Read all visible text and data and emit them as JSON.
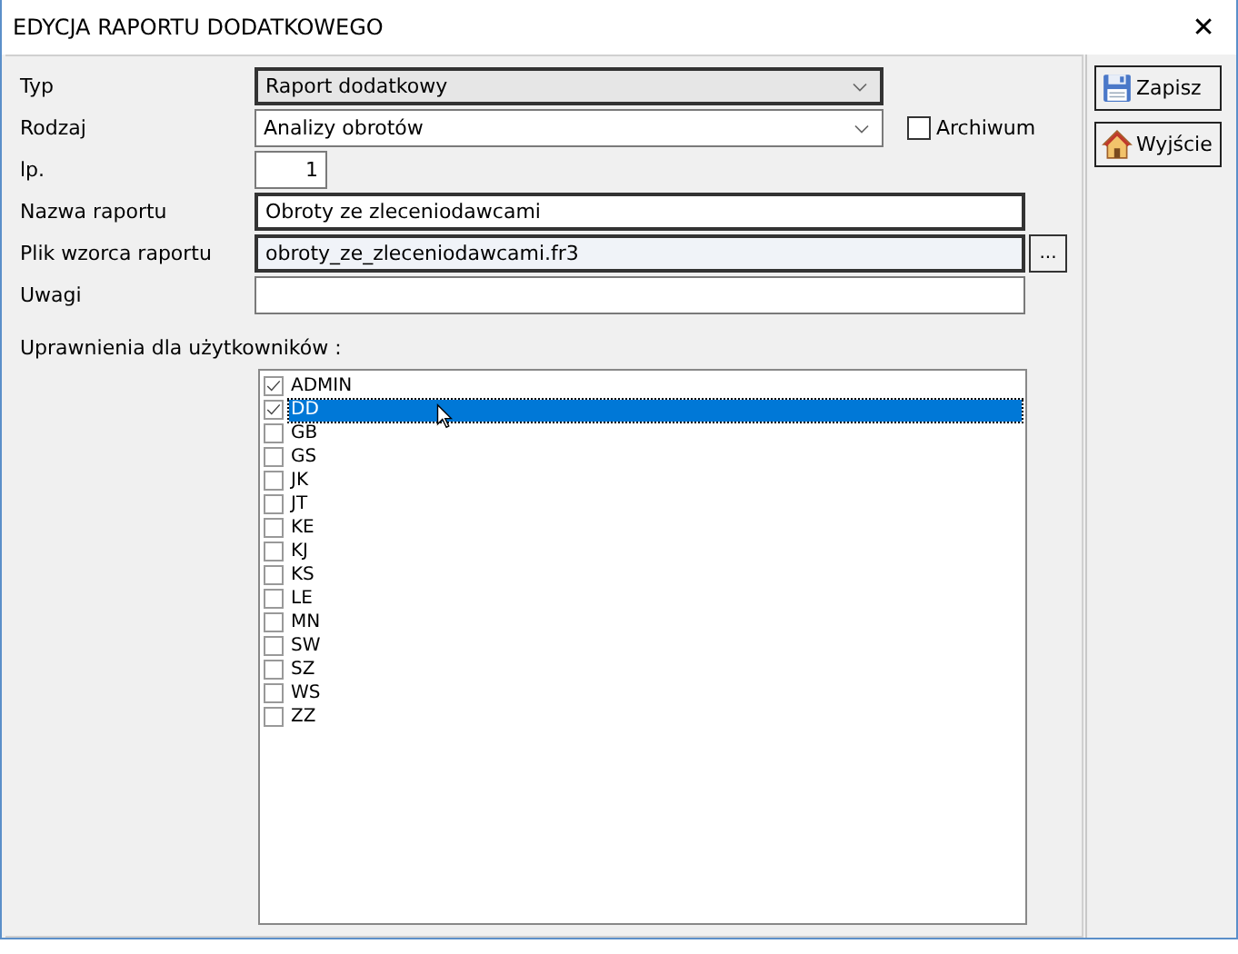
{
  "window": {
    "title": "EDYCJA RAPORTU DODATKOWEGO",
    "close": "✕"
  },
  "form": {
    "fields": [
      {
        "kind": "combo",
        "label": "Typ",
        "value": "Raport dodatkowy",
        "focused": true
      },
      {
        "kind": "combo",
        "label": "Rodzaj",
        "value": "Analizy obrotów",
        "focused": false
      },
      {
        "kind": "number",
        "label": "lp.",
        "value": "1",
        "focused": false
      },
      {
        "kind": "text",
        "label": "Nazwa raportu",
        "value": "Obroty ze zleceniodawcami",
        "focused": true
      },
      {
        "kind": "file",
        "label": "Plik wzorca raportu",
        "value": "obroty_ze_zleceniodawcami.fr3",
        "focused": true,
        "browse": "..."
      },
      {
        "kind": "text",
        "label": "Uwagi",
        "focused": false
      }
    ],
    "archive": {
      "label": "Archiwum",
      "checked": false
    },
    "permissions_label": "Uprawnienia dla użytkowników :",
    "users": [
      {
        "name": "ADMIN",
        "checked": true,
        "selected": false
      },
      {
        "name": "DD",
        "checked": true,
        "selected": true
      },
      {
        "name": "GB",
        "checked": false,
        "selected": false
      },
      {
        "name": "GS",
        "checked": false,
        "selected": false
      },
      {
        "name": "JK",
        "checked": false,
        "selected": false
      },
      {
        "name": "JT",
        "checked": false,
        "selected": false
      },
      {
        "name": "KE",
        "checked": false,
        "selected": false
      },
      {
        "name": "KJ",
        "checked": false,
        "selected": false
      },
      {
        "name": "KS",
        "checked": false,
        "selected": false
      },
      {
        "name": "LE",
        "checked": false,
        "selected": false
      },
      {
        "name": "MN",
        "checked": false,
        "selected": false
      },
      {
        "name": "SW",
        "checked": false,
        "selected": false
      },
      {
        "name": "SZ",
        "checked": false,
        "selected": false
      },
      {
        "name": "WS",
        "checked": false,
        "selected": false
      },
      {
        "name": "ZZ",
        "checked": false,
        "selected": false
      }
    ]
  },
  "buttons": [
    {
      "kind": "save",
      "label": "Zapisz"
    },
    {
      "kind": "exit",
      "label": "Wyjście"
    }
  ]
}
